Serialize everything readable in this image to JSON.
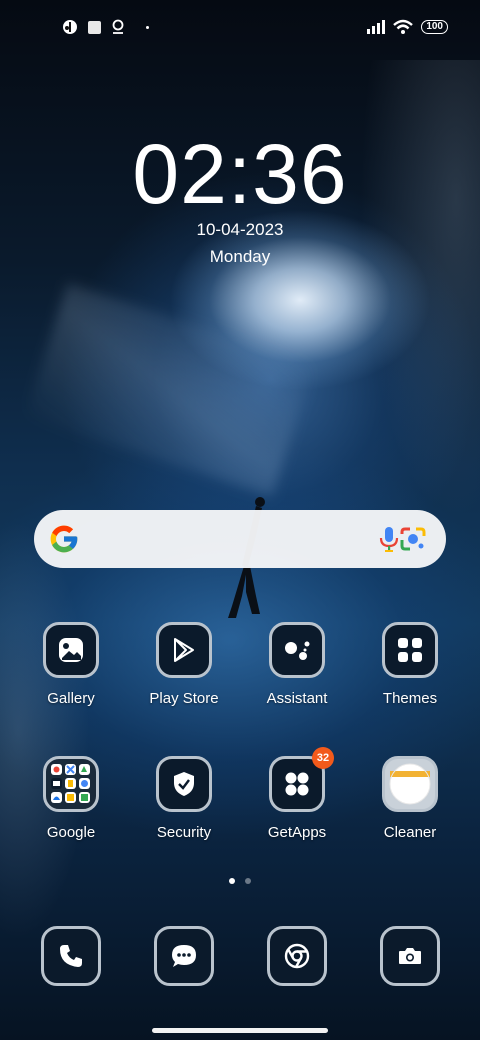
{
  "status": {
    "left_icons": [
      "notification-app-icon",
      "square-icon",
      "location-pin-icon",
      "dot-icon"
    ],
    "battery": "100",
    "right_icons": [
      "signal-icon",
      "wifi-icon",
      "battery-icon"
    ]
  },
  "clock": {
    "time": "02:36",
    "date": "10-04-2023",
    "day": "Monday"
  },
  "search": {
    "icons": [
      "google-g-icon",
      "microphone-icon",
      "lens-camera-icon"
    ]
  },
  "apps": {
    "row1": [
      {
        "label": "Gallery",
        "icon": "gallery-icon"
      },
      {
        "label": "Play Store",
        "icon": "play-store-icon"
      },
      {
        "label": "Assistant",
        "icon": "assistant-icon"
      },
      {
        "label": "Themes",
        "icon": "themes-icon"
      }
    ],
    "row2": [
      {
        "label": "Google",
        "icon": "google-folder-icon"
      },
      {
        "label": "Security",
        "icon": "security-icon"
      },
      {
        "label": "GetApps",
        "icon": "getapps-icon",
        "badge": "32"
      },
      {
        "label": "Cleaner",
        "icon": "cleaner-icon"
      }
    ]
  },
  "page_indicator": {
    "pages": 2,
    "active": 1
  },
  "dock": [
    {
      "icon": "phone-icon"
    },
    {
      "icon": "messages-icon"
    },
    {
      "icon": "chrome-icon"
    },
    {
      "icon": "camera-icon"
    }
  ],
  "colors": {
    "badge": "#f25a1b",
    "icon_bg": "#0b1a2b",
    "icon_border": "#b9c3cd",
    "search_bg": "#f5f6f8"
  }
}
